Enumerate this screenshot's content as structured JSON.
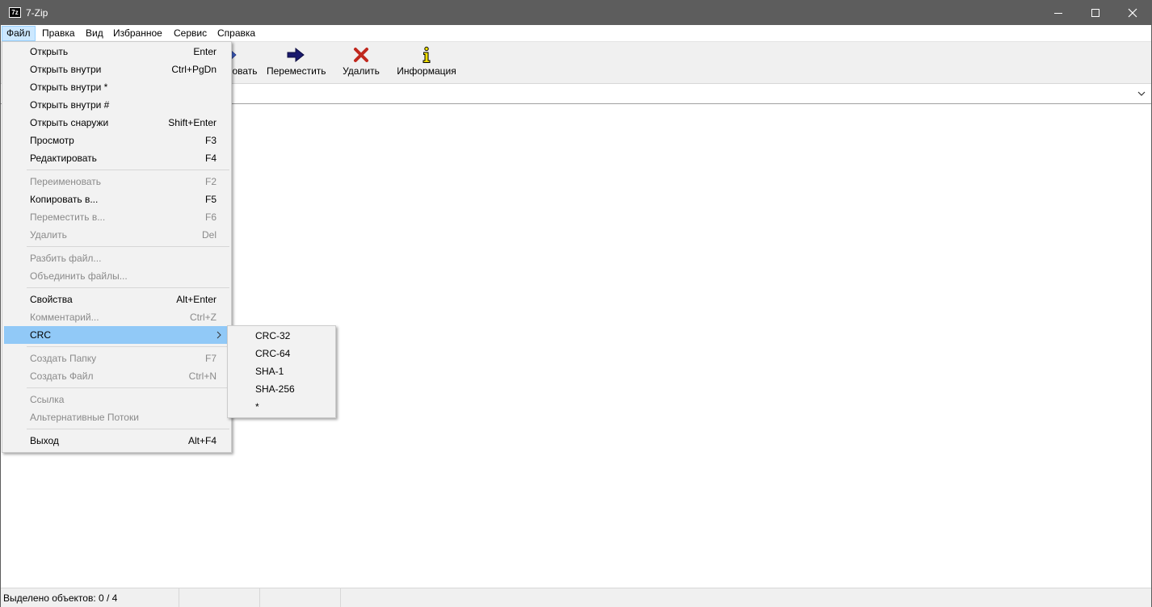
{
  "window": {
    "title": "7-Zip"
  },
  "menubar": {
    "items": [
      {
        "label": "Файл",
        "active": true
      },
      {
        "label": "Правка"
      },
      {
        "label": "Вид"
      },
      {
        "label": "Избранное"
      },
      {
        "label": "Сервис"
      },
      {
        "label": "Справка"
      }
    ]
  },
  "toolbar": {
    "copy_partial_label": "овать",
    "move_label": "Переместить",
    "delete_label": "Удалить",
    "info_label": "Информация"
  },
  "file_menu": {
    "items": [
      {
        "label": "Открыть",
        "shortcut": "Enter",
        "enabled": true
      },
      {
        "label": "Открыть внутри",
        "shortcut": "Ctrl+PgDn",
        "enabled": true
      },
      {
        "label": "Открыть внутри *",
        "shortcut": "",
        "enabled": true
      },
      {
        "label": "Открыть внутри #",
        "shortcut": "",
        "enabled": true
      },
      {
        "label": "Открыть снаружи",
        "shortcut": "Shift+Enter",
        "enabled": true
      },
      {
        "label": "Просмотр",
        "shortcut": "F3",
        "enabled": true
      },
      {
        "label": "Редактировать",
        "shortcut": "F4",
        "enabled": true
      },
      {
        "label": "Переименовать",
        "shortcut": "F2",
        "enabled": false
      },
      {
        "label": "Копировать в...",
        "shortcut": "F5",
        "enabled": true
      },
      {
        "label": "Переместить в...",
        "shortcut": "F6",
        "enabled": false
      },
      {
        "label": "Удалить",
        "shortcut": "Del",
        "enabled": false
      },
      {
        "label": "Разбить файл...",
        "shortcut": "",
        "enabled": false
      },
      {
        "label": "Объединить файлы...",
        "shortcut": "",
        "enabled": false
      },
      {
        "label": "Свойства",
        "shortcut": "Alt+Enter",
        "enabled": true
      },
      {
        "label": "Комментарий...",
        "shortcut": "Ctrl+Z",
        "enabled": false
      },
      {
        "label": "CRC",
        "shortcut": "",
        "enabled": true,
        "highlighted": true,
        "has_submenu": true
      },
      {
        "label": "Создать Папку",
        "shortcut": "F7",
        "enabled": false
      },
      {
        "label": "Создать Файл",
        "shortcut": "Ctrl+N",
        "enabled": false
      },
      {
        "label": "Ссылка",
        "shortcut": "",
        "enabled": false
      },
      {
        "label": "Альтернативные Потоки",
        "shortcut": "",
        "enabled": false
      },
      {
        "label": "Выход",
        "shortcut": "Alt+F4",
        "enabled": true
      }
    ]
  },
  "crc_submenu": {
    "items": [
      "CRC-32",
      "CRC-64",
      "SHA-1",
      "SHA-256",
      "*"
    ]
  },
  "statusbar": {
    "selected": "Выделено объектов: 0 / 4",
    "cell2": "",
    "cell3": "",
    "cell4": ""
  },
  "colors": {
    "titlebar": "#5d5d5d",
    "menu_highlight": "#91c9f7",
    "active_menu": "#cce8ff",
    "disabled_text": "#8a8a8a"
  }
}
